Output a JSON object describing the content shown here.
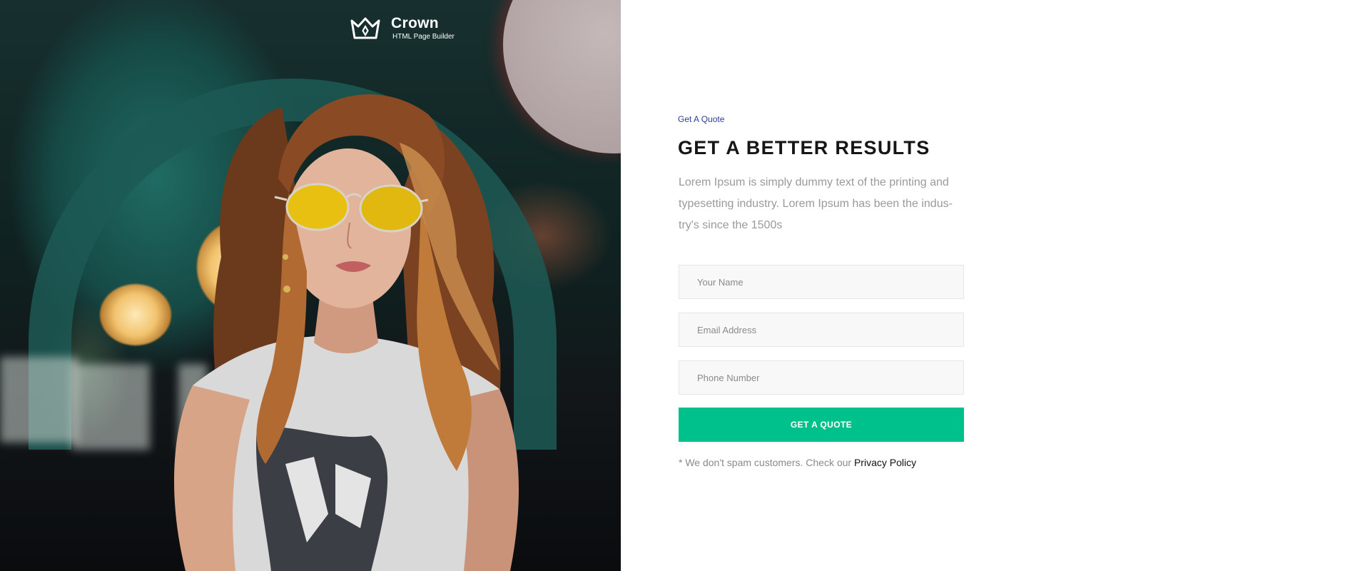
{
  "brand": {
    "name": "Crown",
    "tagline": "HTML Page Builder"
  },
  "hero_image": {
    "subject": "woman-with-yellow-sunglasses-photo"
  },
  "quote_section": {
    "eyebrow": "Get A Quote",
    "title": "GET A BETTER RESULTS",
    "description": "Lorem Ipsum is simply dummy text of the printing and typesetting industry. Lorem Ipsum has been the indus-try's since the 1500s"
  },
  "form": {
    "name_placeholder": "Your Name",
    "email_placeholder": "Email Address",
    "phone_placeholder": "Phone Number",
    "submit_label": "GET A QUOTE",
    "note_text": "* We don't spam customers. Check our ",
    "privacy_link": "Privacy Policy"
  },
  "colors": {
    "accent": "#00c08b",
    "eyebrow": "#2c3e9a",
    "heading": "#161616",
    "body_text": "#9a9a9a",
    "field_bg": "#f8f8f8"
  },
  "icons": {
    "logo": "crown-icon"
  }
}
